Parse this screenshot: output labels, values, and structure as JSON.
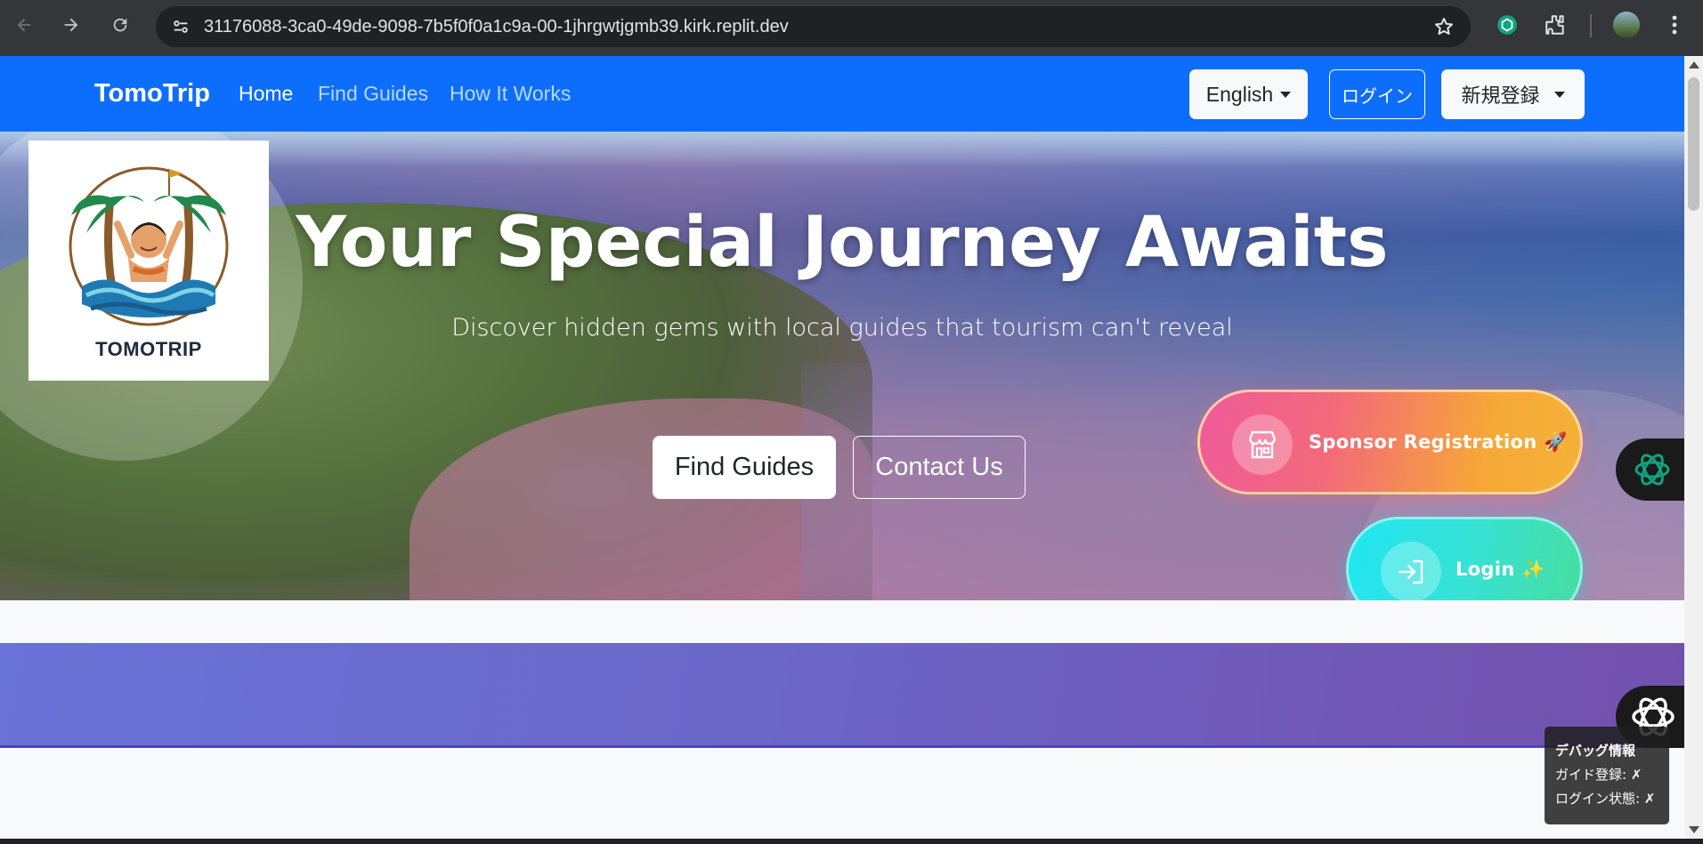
{
  "browser": {
    "url": "31176088-3ca0-49de-9098-7b5f0f0a1c9a-00-1jhrgwtjgmb39.kirk.replit.dev"
  },
  "navbar": {
    "brand": "TomoTrip",
    "links": [
      {
        "label": "Home",
        "active": true
      },
      {
        "label": "Find Guides",
        "active": false
      },
      {
        "label": "How It Works",
        "active": false
      }
    ],
    "language_label": "English",
    "login_label": "ログイン",
    "signup_label": "新規登録",
    "color": "#0d6efd"
  },
  "hero": {
    "logo_text": "TOMOTRIP",
    "title": "Your Special Journey Awaits",
    "subtitle": "Discover hidden gems with local guides that tourism can't reveal",
    "find_guides_label": "Find Guides",
    "contact_label": "Contact Us"
  },
  "floating_buttons": {
    "sponsor_label": "Sponsor Registration 🚀",
    "login_label": "Login ✨"
  },
  "debug": {
    "title": "デバッグ情報",
    "guide_registration": "ガイド登録: ✗",
    "login_status": "ログイン状態: ✗"
  }
}
